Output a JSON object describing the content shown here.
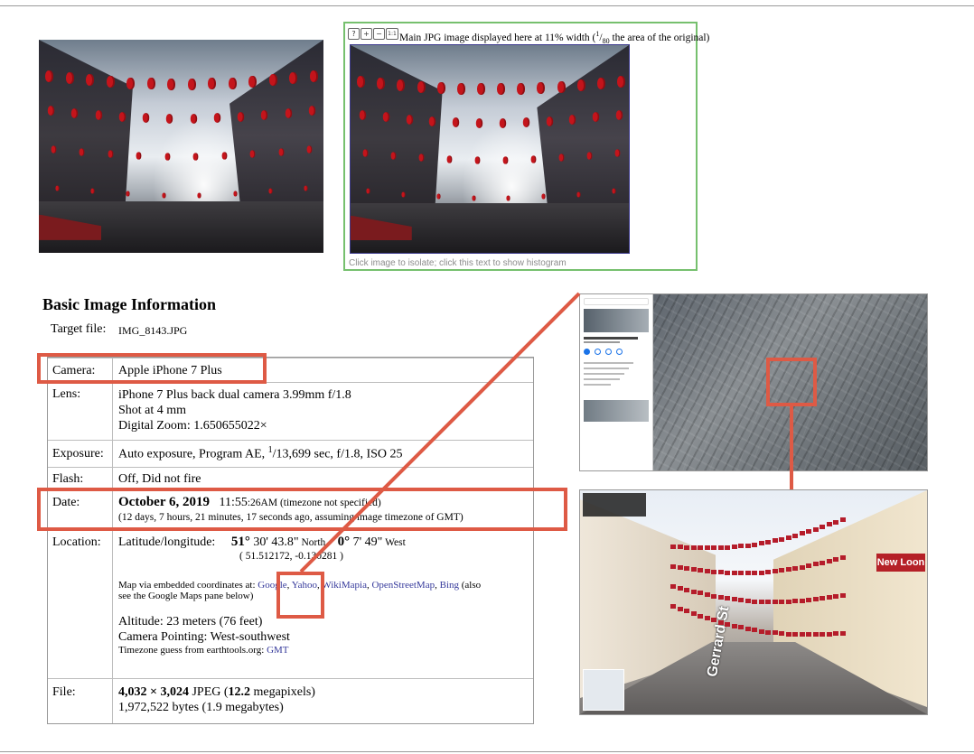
{
  "preview": {
    "caption_main": "Main JPG image displayed here at 11% width (",
    "frac_num": "1",
    "frac_den": "80",
    "caption_rest": " the area of the original)",
    "footer": "Click image to isolate; click this text to show histogram",
    "tool_buttons": [
      {
        "icon": "info-icon",
        "glyph": "?"
      },
      {
        "icon": "zoom-in-icon",
        "glyph": "+"
      },
      {
        "icon": "zoom-out-icon",
        "glyph": "−"
      },
      {
        "icon": "actual-size-icon",
        "glyph": "1:1"
      }
    ]
  },
  "section_title": "Basic Image Information",
  "target_file": {
    "label": "Target file:",
    "value": "IMG_8143.JPG"
  },
  "rows": {
    "camera": {
      "label": "Camera:",
      "value": "Apple iPhone 7 Plus"
    },
    "lens": {
      "label": "Lens:",
      "line1": "iPhone 7 Plus back dual camera 3.99mm f/1.8",
      "line2": "Shot at 4 mm",
      "line3": "Digital Zoom: 1.650655022×"
    },
    "exposure": {
      "label": "Exposure:",
      "pre": "Auto exposure, Program AE, ",
      "num": "1",
      "post": "/13,699 sec, f/1.8, ISO 25"
    },
    "flash": {
      "label": "Flash:",
      "value": "Off, Did not fire"
    },
    "date": {
      "label": "Date:",
      "date": "October 6, 2019",
      "time": "11:55",
      "seconds": ":26AM",
      "tz_note": " (timezone not specified)",
      "ago": "(12 days, 7 hours, 21 minutes, 17 seconds ago, assuming image timezone of GMT)"
    },
    "location": {
      "label": "Location:",
      "latlong_label": "Latitude/longitude:",
      "lat_deg": "51°",
      "lat_rest": " 30' 43.8\"",
      "lat_dir": " North,",
      "lon_deg": "0°",
      "lon_rest": " 7' 49\"",
      "lon_dir": " West",
      "decimal": "( 51.512172, -0.130281 )",
      "map_pre": "Map via embedded coordinates at: ",
      "map_links": [
        "Google",
        "Yahoo",
        "WikiMapia",
        "OpenStreetMap",
        "Bing"
      ],
      "map_post": " (also",
      "map_post2": "see the Google Maps pane below)",
      "altitude": "Altitude: 23 meters (76 feet)",
      "pointing": "Camera Pointing: West-southwest",
      "tz_guess": "Timezone guess from earthtools.org: ",
      "tz_link": "GMT"
    },
    "file": {
      "label": "File:",
      "dims": "4,032 × 3,024",
      "fmt": " JPEG (",
      "mp": "12.2",
      "mp_post": " megapixels)",
      "bytes": "1,972,522 bytes (1.9 megabytes)"
    }
  },
  "street_view": {
    "sign": "New Loon",
    "street_name": "Gerrard St"
  },
  "colors": {
    "accent_red": "#de5a45",
    "preview_border": "#76c06e",
    "link": "#35399b"
  }
}
